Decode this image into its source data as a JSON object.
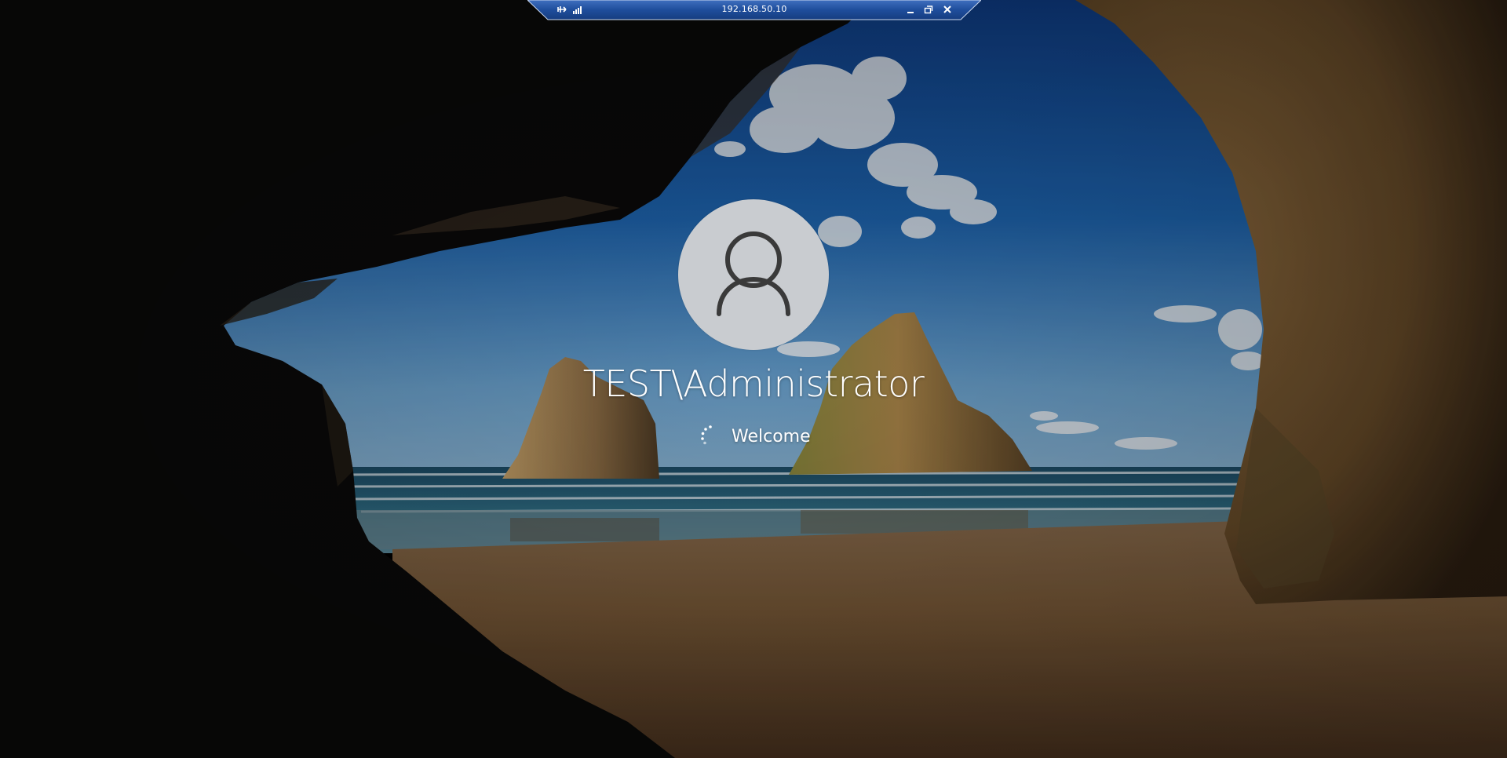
{
  "rdp_bar": {
    "title": "192.168.50.10",
    "color": "#1f4e9c"
  },
  "login": {
    "username": "TEST\\Administrator",
    "status": "Welcome"
  },
  "icons": {
    "pin": "pin-icon",
    "signal": "connection-signal-icon",
    "minimize": "minimize-icon",
    "restore": "restore-icon",
    "close": "close-icon",
    "user": "user-avatar-icon",
    "spinner": "loading-spinner-icon"
  }
}
